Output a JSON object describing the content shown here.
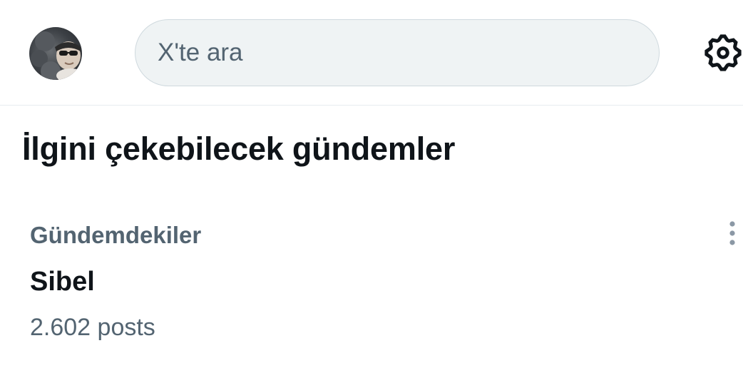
{
  "header": {
    "avatar": "profile-avatar",
    "search": {
      "placeholder": "X'te ara",
      "value": ""
    },
    "settings_icon": "gear-icon"
  },
  "section": {
    "title": "İlgini çekebilecek gündemler"
  },
  "trends": [
    {
      "context": "Gündemdekiler",
      "name": "Sibel",
      "posts": "2.602 posts",
      "more_icon": "more-vertical-icon"
    }
  ],
  "colors": {
    "text_primary": "#0f1419",
    "text_secondary": "#536471",
    "search_bg": "#eff3f4",
    "search_border": "#cfd9de",
    "divider": "#e6ecf0"
  }
}
